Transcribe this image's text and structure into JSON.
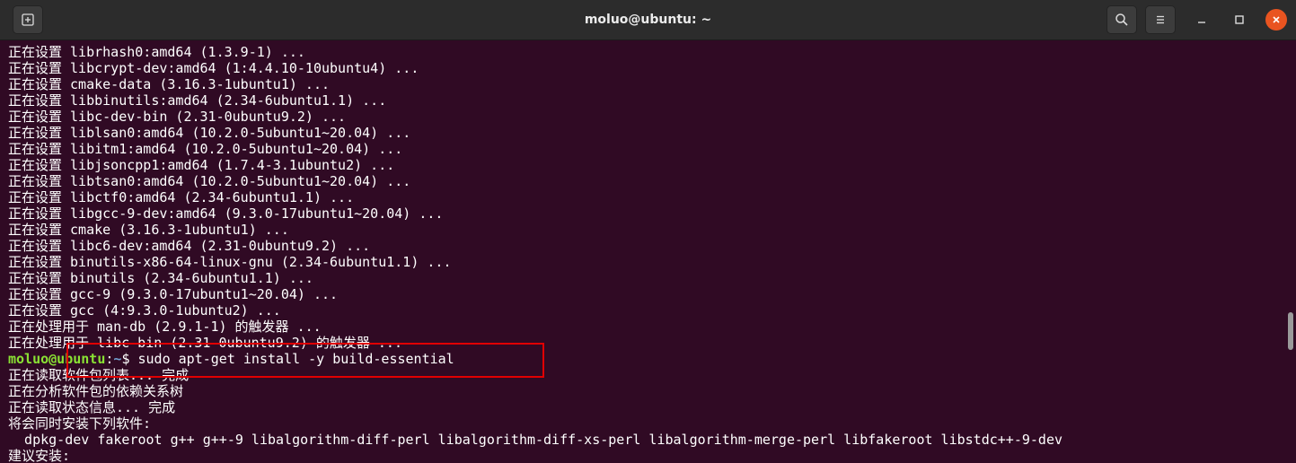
{
  "window": {
    "title": "moluo@ubuntu: ~"
  },
  "icons": {
    "new_tab": "new-tab-icon",
    "search": "search-icon",
    "menu": "hamburger-menu-icon",
    "minimize": "minimize-icon",
    "maximize": "maximize-icon",
    "close": "close-icon"
  },
  "colors": {
    "terminal_bg": "#300a24",
    "titlebar_bg": "#2c2c2c",
    "prompt_user": "#8ae234",
    "prompt_path": "#729fcf",
    "close_button": "#e95420",
    "highlight_box": "#e00000"
  },
  "terminal": {
    "output_before": [
      "正在设置 librhash0:amd64 (1.3.9-1) ...",
      "正在设置 libcrypt-dev:amd64 (1:4.4.10-10ubuntu4) ...",
      "正在设置 cmake-data (3.16.3-1ubuntu1) ...",
      "正在设置 libbinutils:amd64 (2.34-6ubuntu1.1) ...",
      "正在设置 libc-dev-bin (2.31-0ubuntu9.2) ...",
      "正在设置 liblsan0:amd64 (10.2.0-5ubuntu1~20.04) ...",
      "正在设置 libitm1:amd64 (10.2.0-5ubuntu1~20.04) ...",
      "正在设置 libjsoncpp1:amd64 (1.7.4-3.1ubuntu2) ...",
      "正在设置 libtsan0:amd64 (10.2.0-5ubuntu1~20.04) ...",
      "正在设置 libctf0:amd64 (2.34-6ubuntu1.1) ...",
      "正在设置 libgcc-9-dev:amd64 (9.3.0-17ubuntu1~20.04) ...",
      "正在设置 cmake (3.16.3-1ubuntu1) ...",
      "正在设置 libc6-dev:amd64 (2.31-0ubuntu9.2) ...",
      "正在设置 binutils-x86-64-linux-gnu (2.34-6ubuntu1.1) ...",
      "正在设置 binutils (2.34-6ubuntu1.1) ...",
      "正在设置 gcc-9 (9.3.0-17ubuntu1~20.04) ...",
      "正在设置 gcc (4:9.3.0-1ubuntu2) ...",
      "正在处理用于 man-db (2.9.1-1) 的触发器 ...",
      "正在处理用于 libc-bin (2.31-0ubuntu9.2) 的触发器 ..."
    ],
    "prompt": {
      "user_host": "moluo@ubuntu",
      "separator": ":",
      "path": "~",
      "symbol": "$ ",
      "command": "sudo apt-get install -y build-essential"
    },
    "output_after": [
      "正在读取软件包列表... 完成",
      "正在分析软件包的依赖关系树",
      "正在读取状态信息... 完成",
      "将会同时安装下列软件:",
      "  dpkg-dev fakeroot g++ g++-9 libalgorithm-diff-perl libalgorithm-diff-xs-perl libalgorithm-merge-perl libfakeroot libstdc++-9-dev",
      "建议安装:"
    ]
  }
}
